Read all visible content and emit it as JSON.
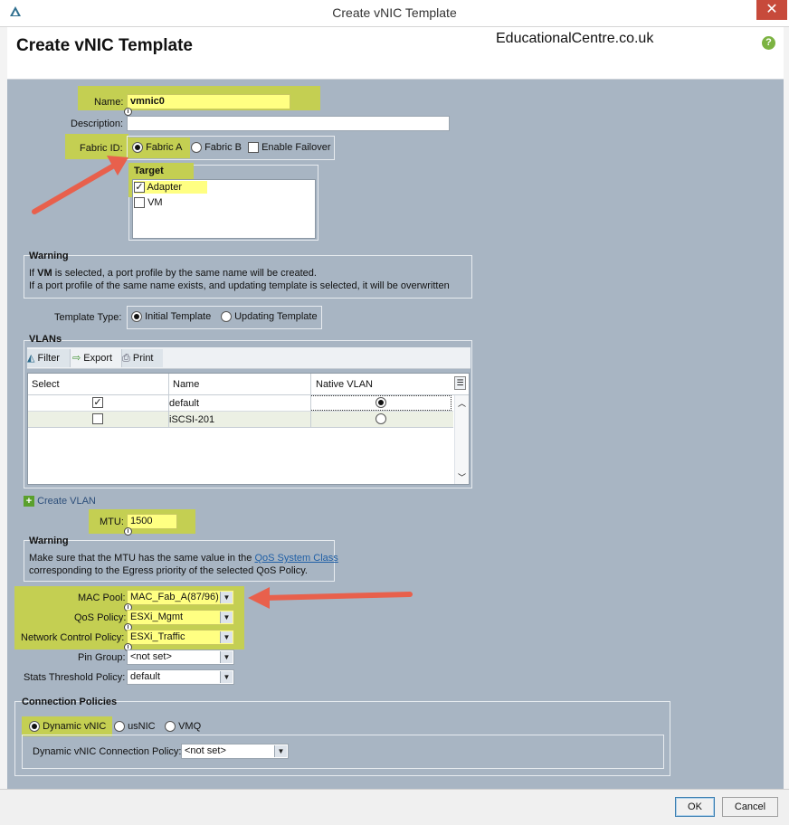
{
  "window": {
    "title": "Create vNIC Template",
    "close_glyph": "✕"
  },
  "header": {
    "title": "Create vNIC Template",
    "watermark": "EducationalCentre.co.uk",
    "help_glyph": "?"
  },
  "form": {
    "name_label": "Name:",
    "name_value": "vmnic0",
    "description_label": "Description:",
    "description_value": "",
    "fabric_label": "Fabric ID:",
    "fabric_options": [
      "Fabric A",
      "Fabric B"
    ],
    "fabric_selected": "Fabric A",
    "enable_failover_label": "Enable Failover",
    "enable_failover_checked": false,
    "info_glyph": "i"
  },
  "target": {
    "title": "Target",
    "items": [
      {
        "label": "Adapter",
        "checked": true
      },
      {
        "label": "VM",
        "checked": false
      }
    ]
  },
  "warning1": {
    "title": "Warning",
    "line1_prefix": "If ",
    "line1_bold": "VM",
    "line1_suffix": " is selected, a port profile by the same name will be created.",
    "line2": "If a port profile of the same name exists, and updating template is selected, it will be overwritten"
  },
  "template_type": {
    "label": "Template Type:",
    "options": [
      "Initial Template",
      "Updating Template"
    ],
    "selected": "Initial Template"
  },
  "vlans": {
    "title": "VLANs",
    "toolbar": [
      "Filter",
      "Export",
      "Print"
    ],
    "columns": [
      "Select",
      "Name",
      "Native VLAN"
    ],
    "rows": [
      {
        "select": true,
        "name": "default",
        "native": true
      },
      {
        "select": false,
        "name": "iSCSI-201",
        "native": false
      }
    ],
    "create_label": "Create VLAN"
  },
  "mtu": {
    "label": "MTU:",
    "value": "1500"
  },
  "warning2": {
    "title": "Warning",
    "line1_prefix": "Make sure that the MTU has the same value in the ",
    "line1_link": "QoS System Class",
    "line2": "corresponding to the Egress priority of the selected QoS Policy."
  },
  "policies": {
    "mac_pool_label": "MAC Pool:",
    "mac_pool_value": "MAC_Fab_A(87/96)",
    "qos_label": "QoS Policy:",
    "qos_value": "ESXi_Mgmt",
    "ncp_label": "Network Control Policy:",
    "ncp_value": "ESXi_Traffic",
    "pin_label": "Pin Group:",
    "pin_value": "<not set>",
    "stats_label": "Stats Threshold Policy:",
    "stats_value": "default"
  },
  "connection": {
    "title": "Connection Policies",
    "options": [
      "Dynamic vNIC",
      "usNIC",
      "VMQ"
    ],
    "selected": "Dynamic vNIC",
    "dvnic_label": "Dynamic vNIC Connection Policy:",
    "dvnic_value": "<not set>"
  },
  "footer": {
    "ok": "OK",
    "cancel": "Cancel"
  },
  "colors": {
    "accent_highlight": "#c4cf52",
    "field_yellow": "#ffff82",
    "arrow": "#e8604c",
    "panel": "#a8b5c3"
  }
}
